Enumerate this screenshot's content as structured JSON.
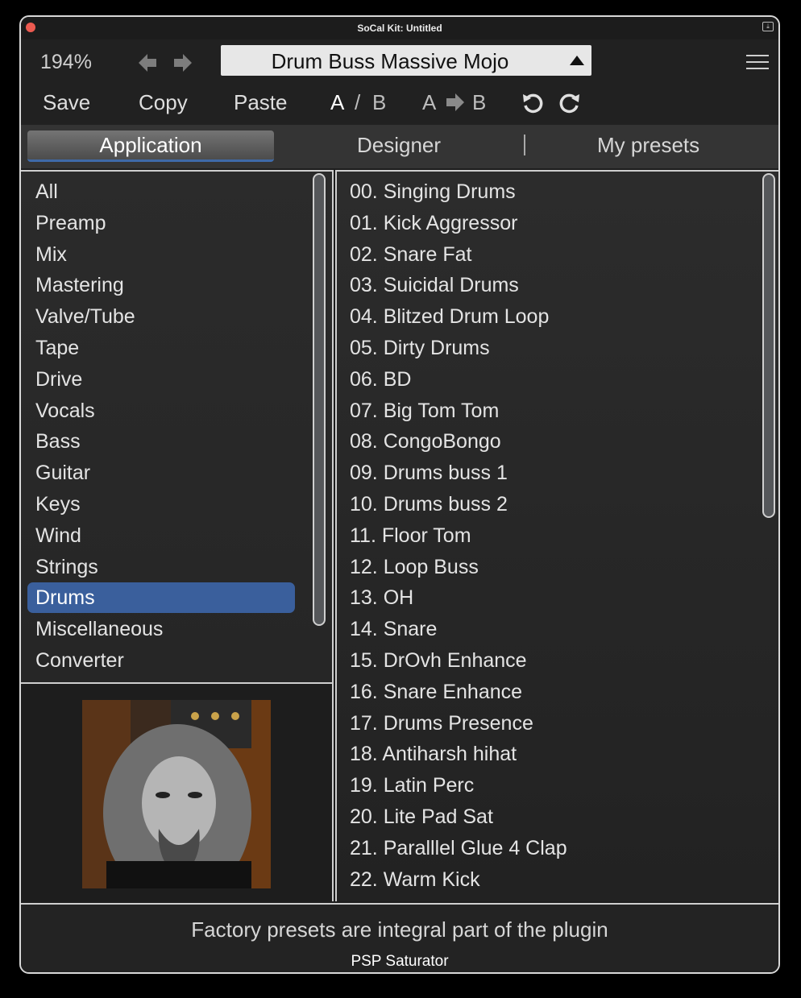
{
  "window": {
    "title": "SoCal Kit: Untitled"
  },
  "toolbar": {
    "zoom": "194%",
    "preset_name": "Drum Buss Massive Mojo",
    "save": "Save",
    "copy": "Copy",
    "paste": "Paste",
    "a": "A",
    "slash": "/",
    "b": "B",
    "a2": "A",
    "b2": "B"
  },
  "tabs": {
    "application": "Application",
    "designer": "Designer",
    "my_presets": "My presets"
  },
  "categories": [
    "All",
    "Preamp",
    "Mix",
    "Mastering",
    "Valve/Tube",
    "Tape",
    "Drive",
    "Vocals",
    "Bass",
    "Guitar",
    "Keys",
    "Wind",
    "Strings",
    "Drums",
    "Miscellaneous",
    "Converter"
  ],
  "selected_category": "Drums",
  "presets": [
    "00. Singing Drums",
    "01. Kick Aggressor",
    "02. Snare Fat",
    "03. Suicidal Drums",
    "04. Blitzed Drum Loop",
    "05. Dirty Drums",
    "06. BD",
    "07. Big Tom Tom",
    "08. CongoBongo",
    "09. Drums buss 1",
    "10. Drums buss 2",
    "11. Floor Tom",
    "12. Loop Buss",
    "13. OH",
    "14. Snare",
    "15. DrOvh Enhance",
    "16. Snare Enhance",
    "17. Drums Presence",
    "18. Antiharsh hihat",
    "19. Latin Perc",
    "20. Lite Pad Sat",
    "21. Paralllel Glue 4 Clap",
    "22. Warm Kick"
  ],
  "footer": {
    "message": "Factory presets are integral part of the plugin",
    "plugin_name": "PSP Saturator"
  },
  "colors": {
    "selection": "#3a5f9c",
    "accent": "#3f6aa8",
    "close": "#ec5a50"
  }
}
